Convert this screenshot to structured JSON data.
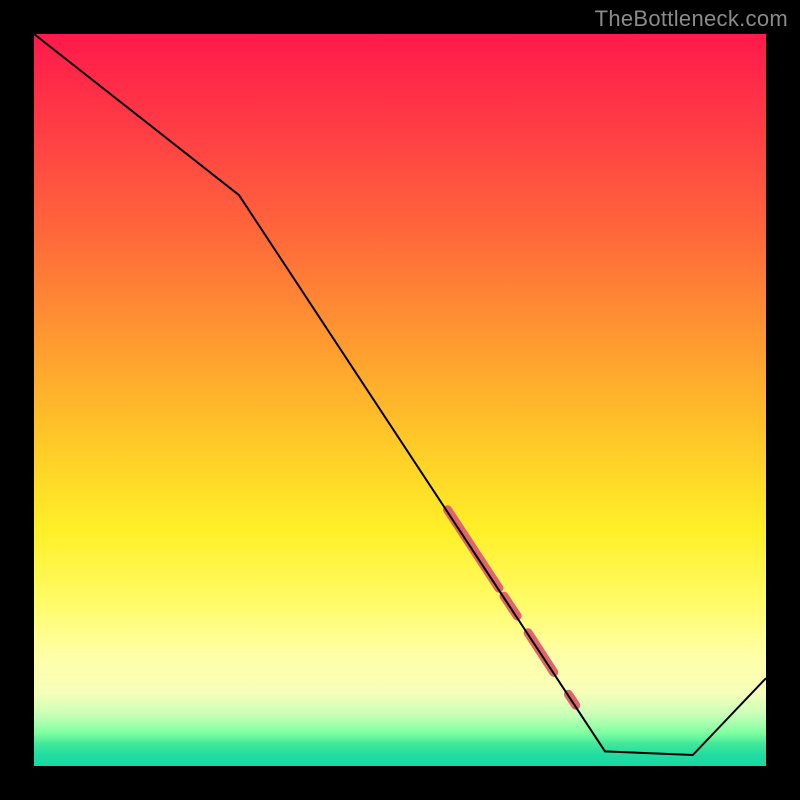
{
  "watermark": "TheBottleneck.com",
  "chart_data": {
    "type": "line",
    "title": "",
    "xlabel": "",
    "ylabel": "",
    "xlim": [
      0,
      100
    ],
    "ylim": [
      0,
      100
    ],
    "grid": false,
    "legend": false,
    "series": [
      {
        "name": "curve",
        "x": [
          0,
          28,
          78,
          90,
          100
        ],
        "values": [
          100,
          78,
          2,
          1.5,
          12
        ],
        "stroke": "#000000",
        "stroke_width": 2
      }
    ],
    "highlights": [
      {
        "name": "highlight-segments",
        "color": "#e0646a",
        "width": 9,
        "points": [
          {
            "x1": 56.5,
            "y1": 35.0,
            "x2": 63.5,
            "y2": 24.3
          },
          {
            "x1": 64.2,
            "y1": 23.2,
            "x2": 66.0,
            "y2": 20.5
          },
          {
            "x1": 67.5,
            "y1": 18.2,
            "x2": 71.0,
            "y2": 12.8
          },
          {
            "x1": 73.0,
            "y1": 9.8,
            "x2": 74.0,
            "y2": 8.3
          }
        ]
      }
    ],
    "gradient_stops": [
      {
        "pos": 0,
        "color": "#ff1a4b"
      },
      {
        "pos": 0.56,
        "color": "#ffca28"
      },
      {
        "pos": 0.85,
        "color": "#ffffa8"
      },
      {
        "pos": 1.0,
        "color": "#18d8a4"
      }
    ]
  }
}
